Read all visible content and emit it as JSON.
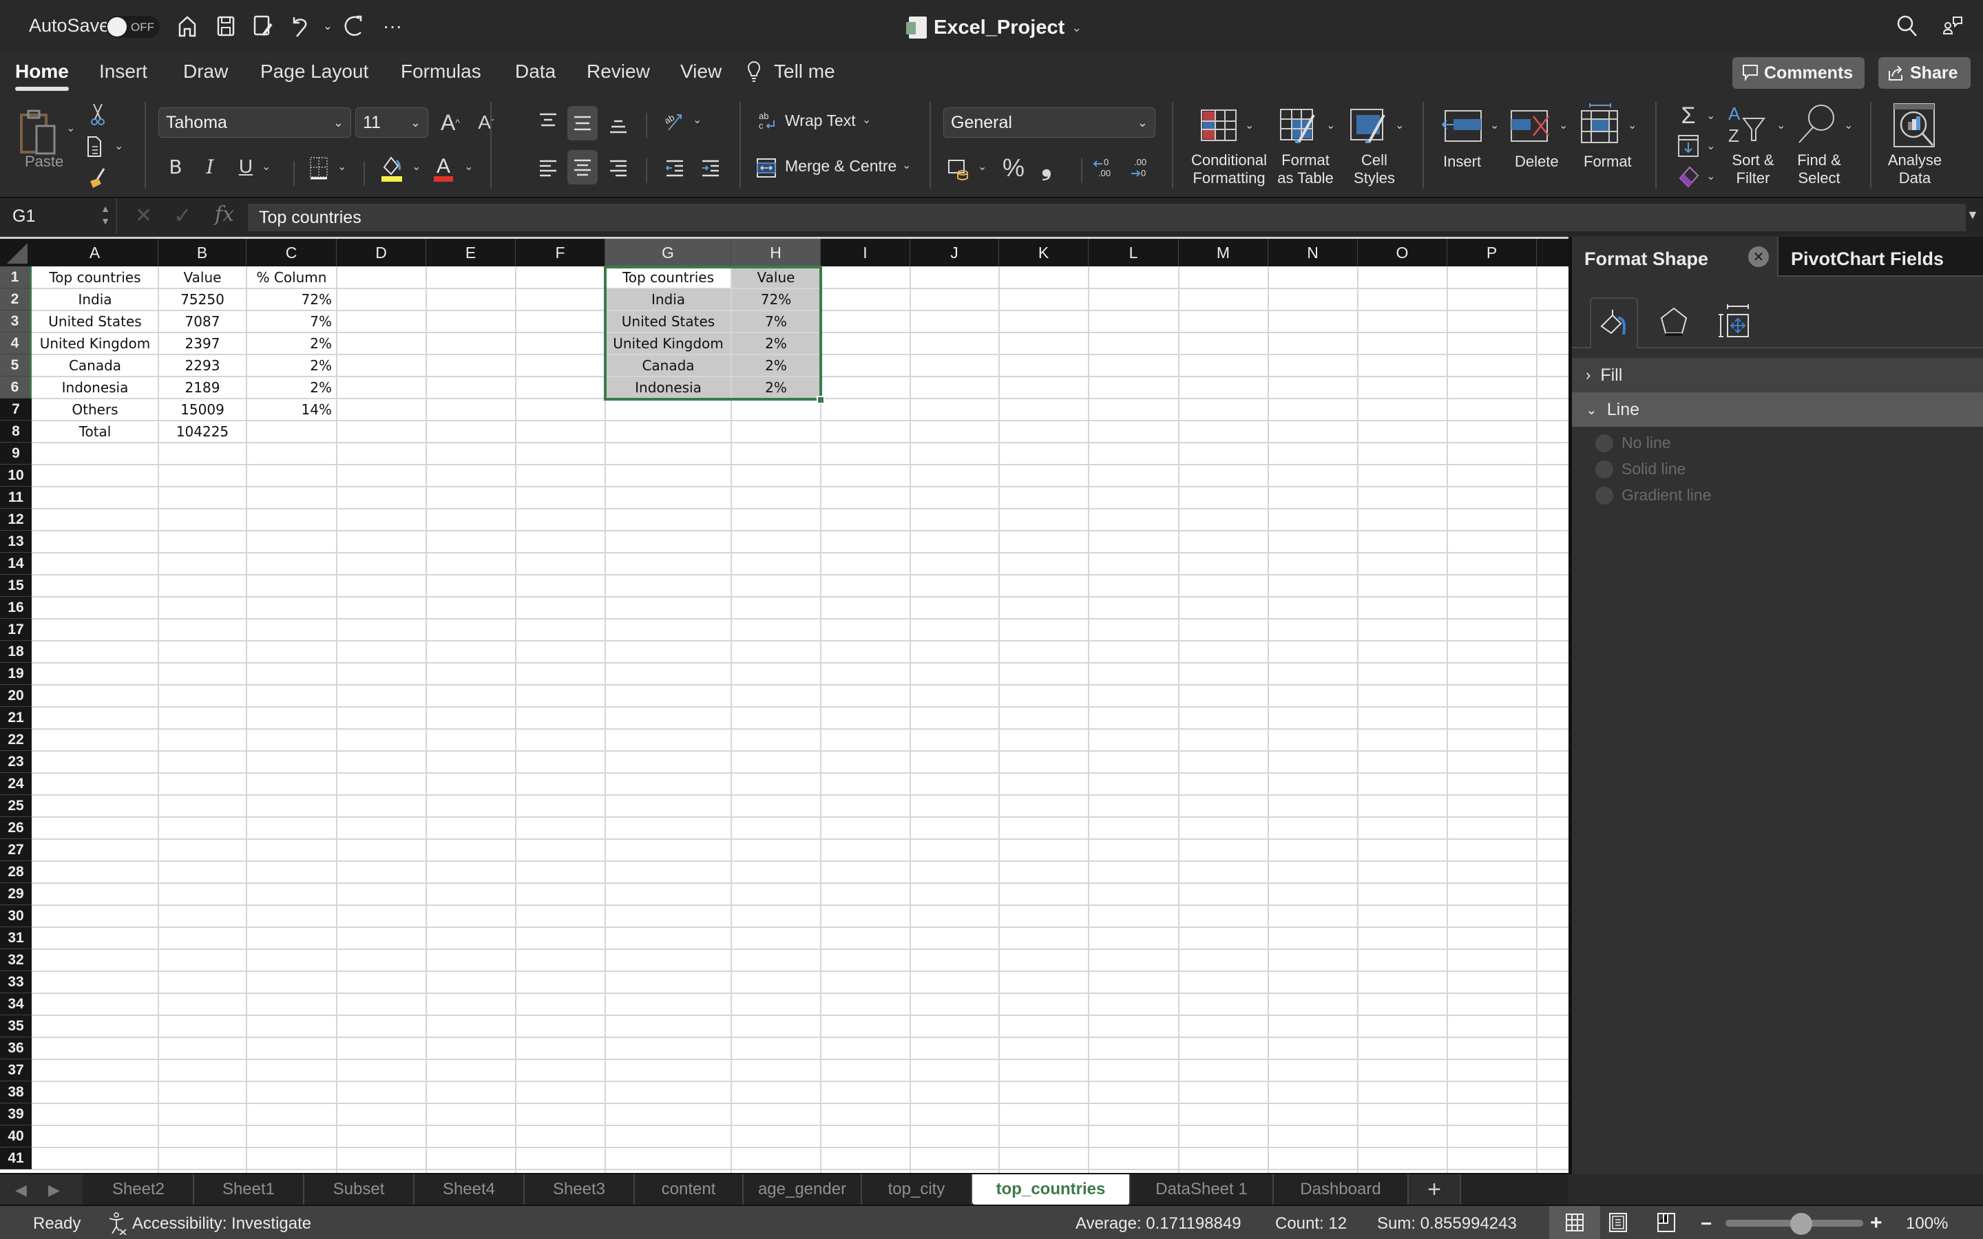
{
  "titlebar": {
    "autosave_label": "AutoSave",
    "autosave_state": "OFF",
    "document_title": "Excel_Project",
    "icons": [
      "home-icon",
      "save-icon",
      "save-as-icon",
      "undo-icon",
      "redo-icon",
      "more-icon",
      "search-icon",
      "share-people-icon"
    ]
  },
  "menu": {
    "tabs": [
      "Home",
      "Insert",
      "Draw",
      "Page Layout",
      "Formulas",
      "Data",
      "Review",
      "View"
    ],
    "active_tab": "Home",
    "tell_me": "Tell me",
    "comments_label": "Comments",
    "share_label": "Share"
  },
  "ribbon": {
    "paste_label": "Paste",
    "font_name": "Tahoma",
    "font_size": "11",
    "bold": "B",
    "italic": "I",
    "underline": "U",
    "wrap_text": "Wrap Text",
    "merge_centre": "Merge & Centre",
    "number_format": "General",
    "percent": "%",
    "comma": "9",
    "conditional_formatting": [
      "Conditional",
      "Formatting"
    ],
    "format_as_table": [
      "Format",
      "as Table"
    ],
    "cell_styles": [
      "Cell",
      "Styles"
    ],
    "insert": "Insert",
    "delete": "Delete",
    "format": "Format",
    "sort_filter": [
      "Sort &",
      "Filter"
    ],
    "find_select": [
      "Find &",
      "Select"
    ],
    "analyse_data": [
      "Analyse",
      "Data"
    ],
    "colors": {
      "highlight": "#f5f04a",
      "font_color": "#e0332b"
    }
  },
  "formula_bar": {
    "name_box": "G1",
    "formula": "Top countries"
  },
  "sheet": {
    "columns": [
      "A",
      "B",
      "C",
      "D",
      "E",
      "F",
      "G",
      "H",
      "I",
      "J",
      "K",
      "L",
      "M",
      "N",
      "O",
      "P"
    ],
    "rows": [
      "1",
      "2",
      "3",
      "4",
      "5",
      "6",
      "7",
      "8",
      "9",
      "10",
      "11",
      "12",
      "13",
      "14",
      "15",
      "16",
      "17",
      "18",
      "19",
      "20",
      "21",
      "22",
      "23",
      "24",
      "25",
      "26",
      "27",
      "28",
      "29",
      "30",
      "31",
      "32",
      "33",
      "34",
      "35",
      "36",
      "37",
      "38",
      "39",
      "40",
      "41"
    ],
    "table1": {
      "headers": [
        "Top countries",
        "Value",
        "% Column"
      ],
      "rows": [
        [
          "India",
          "75250",
          "72%"
        ],
        [
          "United States",
          "7087",
          "7%"
        ],
        [
          "United Kingdom",
          "2397",
          "2%"
        ],
        [
          "Canada",
          "2293",
          "2%"
        ],
        [
          "Indonesia",
          "2189",
          "2%"
        ],
        [
          "Others",
          "15009",
          "14%"
        ],
        [
          "Total",
          "104225",
          ""
        ]
      ]
    },
    "table2": {
      "headers": [
        "Top countries",
        "Value"
      ],
      "rows": [
        [
          "India",
          "72%"
        ],
        [
          "United States",
          "7%"
        ],
        [
          "United Kingdom",
          "2%"
        ],
        [
          "Canada",
          "2%"
        ],
        [
          "Indonesia",
          "2%"
        ]
      ]
    },
    "selection_color": "#3c7a4b"
  },
  "pane": {
    "tab_format_shape": "Format Shape",
    "tab_pivotchart_fields": "PivotChart Fields",
    "sections": {
      "fill": "Fill",
      "line": "Line"
    },
    "line_options": [
      "No line",
      "Solid line",
      "Gradient line"
    ]
  },
  "sheet_tabs": {
    "tabs": [
      "Sheet2",
      "Sheet1",
      "Subset",
      "Sheet4",
      "Sheet3",
      "content",
      "age_gender",
      "top_city",
      "top_countries",
      "DataSheet 1",
      "Dashboard"
    ],
    "active": "top_countries",
    "add_label": "+"
  },
  "status": {
    "ready": "Ready",
    "accessibility": "Accessibility: Investigate",
    "average": "Average: 0.171198849",
    "count": "Count: 12",
    "sum": "Sum: 0.855994243",
    "zoom": "100%",
    "zoom_level": 100
  }
}
